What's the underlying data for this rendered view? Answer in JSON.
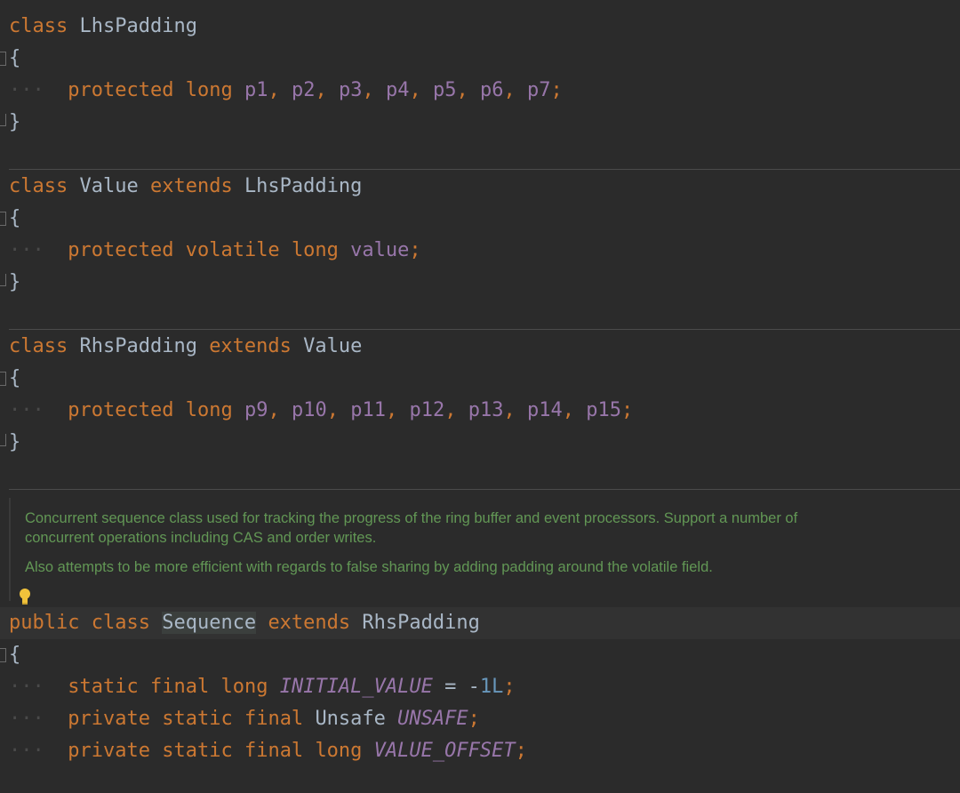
{
  "colors": {
    "background": "#2b2b2b",
    "keyword": "#cc7832",
    "field": "#9876aa",
    "number": "#6897bb",
    "doc_comment": "#629755",
    "plain": "#a9b7c6"
  },
  "blocks": {
    "lhs": {
      "header": {
        "kw_class": "class",
        "name": "LhsPadding"
      },
      "open": "{",
      "body": {
        "indent": "···",
        "kw_protected": "protected",
        "kw_long": "long",
        "fields": [
          "p1",
          "p2",
          "p3",
          "p4",
          "p5",
          "p6",
          "p7"
        ],
        "end": ";"
      },
      "close": "}"
    },
    "value": {
      "header": {
        "kw_class": "class",
        "name": "Value",
        "kw_extends": "extends",
        "parent": "LhsPadding"
      },
      "open": "{",
      "body": {
        "indent": "···",
        "kw_protected": "protected",
        "kw_volatile": "volatile",
        "kw_long": "long",
        "field": "value",
        "end": ";"
      },
      "close": "}"
    },
    "rhs": {
      "header": {
        "kw_class": "class",
        "name": "RhsPadding",
        "kw_extends": "extends",
        "parent": "Value"
      },
      "open": "{",
      "body": {
        "indent": "···",
        "kw_protected": "protected",
        "kw_long": "long",
        "fields": [
          "p9",
          "p10",
          "p11",
          "p12",
          "p13",
          "p14",
          "p15"
        ],
        "end": ";"
      },
      "close": "}"
    },
    "doc": {
      "para1": "Concurrent sequence class used for tracking the progress of the ring buffer and event processors. Support a number of concurrent operations including CAS and order writes.",
      "para2": "Also attempts to be more efficient with regards to false sharing by adding padding around the volatile field."
    },
    "sequence": {
      "header": {
        "kw_public": "public",
        "kw_class": "class",
        "name": "Sequence",
        "kw_extends": "extends",
        "parent": "RhsPadding"
      },
      "open": "{",
      "line1": {
        "indent": "···",
        "kw_static": "static",
        "kw_final": "final",
        "kw_long": "long",
        "field": "INITIAL_VALUE",
        "op": "=",
        "minus": "-",
        "num": "1L",
        "end": ";"
      },
      "line2": {
        "indent": "···",
        "kw_private": "private",
        "kw_static": "static",
        "kw_final": "final",
        "type": "Unsafe",
        "field": "UNSAFE",
        "end": ";"
      },
      "line3": {
        "indent": "···",
        "kw_private": "private",
        "kw_static": "static",
        "kw_final": "final",
        "kw_long": "long",
        "field": "VALUE_OFFSET",
        "end": ";"
      }
    }
  },
  "icons": {
    "fold": "fold-marker-icon",
    "bulb": "lightbulb-icon"
  }
}
